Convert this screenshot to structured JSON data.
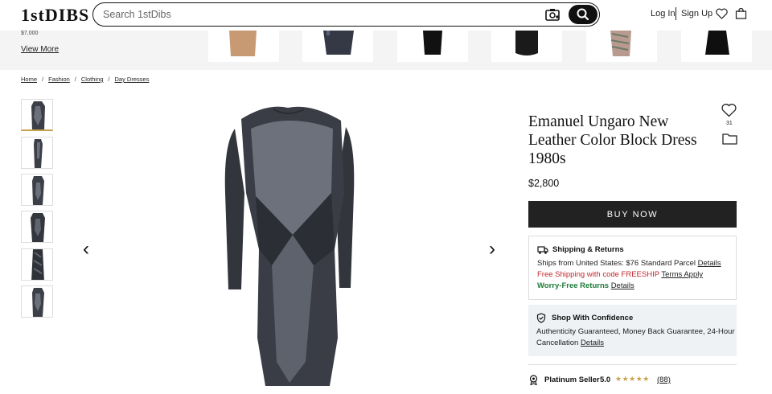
{
  "header": {
    "logo": "1stDIBS",
    "search_placeholder": "Search 1stDibs",
    "login": "Log In",
    "signup": "Sign Up"
  },
  "recommended": {
    "price_snippet": "$7,000",
    "view_more": "View More"
  },
  "breadcrumbs": [
    "Home",
    "Fashion",
    "Clothing",
    "Day Dresses"
  ],
  "product": {
    "title": "Emanuel Ungaro New Leather Color Block Dress 1980s",
    "favorites_count": "31",
    "price": "$2,800",
    "buy_label": "BUY NOW"
  },
  "shipping": {
    "title": "Shipping & Returns",
    "line1": "Ships from United States: $76 Standard Parcel",
    "line1_link": "Details",
    "line2": "Free Shipping with code FREESHIP",
    "line2_link": "Terms Apply",
    "line3": "Worry-Free Returns",
    "line3_link": "Details"
  },
  "confidence": {
    "title": "Shop With Confidence",
    "line1": "Authenticity Guaranteed, Money Back Guarantee, 24-Hour",
    "line2": "Cancellation",
    "link": "Details"
  },
  "seller": {
    "tier": "Platinum Seller",
    "rating": "5.0",
    "stars": "★★★★★",
    "reviews": "(88)"
  },
  "colors": {
    "accent_gold": "#c8a24a",
    "promo_red": "#c2272d",
    "returns_green": "#1e7a3a",
    "button_dark": "#222222"
  }
}
